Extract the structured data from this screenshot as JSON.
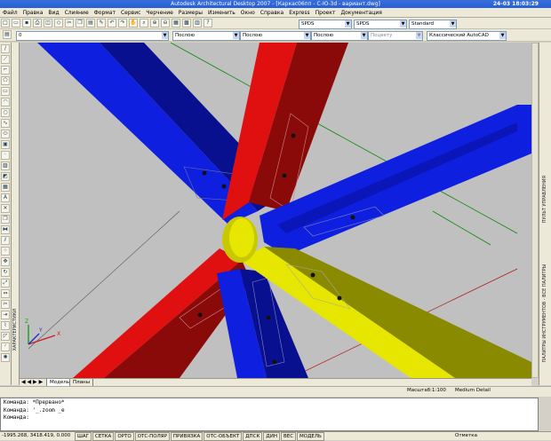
{
  "window": {
    "title": "Autodesk Architectural Desktop 2007 - [Каркас06пп - С-Ю-3d - вариант.dwg]",
    "clock": "24-03 18:03:29"
  },
  "menu": [
    "Файл",
    "Правка",
    "Вид",
    "Слияние",
    "Формат",
    "Сервис",
    "Черчение",
    "Размеры",
    "Изменить",
    "Окно",
    "Справка",
    "Express",
    "Проект",
    "Документация"
  ],
  "toolbar1": {
    "textstyle": "SPDS",
    "dimstyle": "SPDS",
    "tablestyle": "Standard"
  },
  "toolbar2": {
    "layer": "0",
    "color": "Послою",
    "linetype": "Послою",
    "lineweight": "Послою",
    "plotstyle": "Поцвету",
    "workspace": "Классический AutoCAD"
  },
  "tabs": {
    "model": "Модель",
    "layout": "Планы"
  },
  "status_right": {
    "scale": "Масштаб:",
    "scale_value": "1:100",
    "detail": "Medium Detail"
  },
  "command_lines": [
    "Команда: *Прервано*",
    "Команда: '_.zoom _e",
    "Команда:"
  ],
  "coords": "-1995.268, 3418.419, 0.000",
  "status_buttons": [
    "ШАГ",
    "СЕТКА",
    "ОРТО",
    "ОТС-ПОЛЯР",
    "ПРИВЯЗКА",
    "ОТС-ОБЪЕКТ",
    "ДПСК",
    "ДИН",
    "ВЕС",
    "МОДЕЛЬ"
  ],
  "status_tail": "Отметка",
  "left_panel_label": "ХАРАКТЕРИСТИКИ",
  "right_panel_labels": [
    "ПУЛЬТ УПРАВЛЕНИЯ",
    "ПАЛИТРЫ ИНСТРУМЕНТОВ - ВСЕ ПАЛИТРЫ"
  ],
  "colors": {
    "blue": "#0f1fe0",
    "red": "#e01010",
    "yellow": "#e6e600",
    "viewport": "#c0c0c0"
  }
}
